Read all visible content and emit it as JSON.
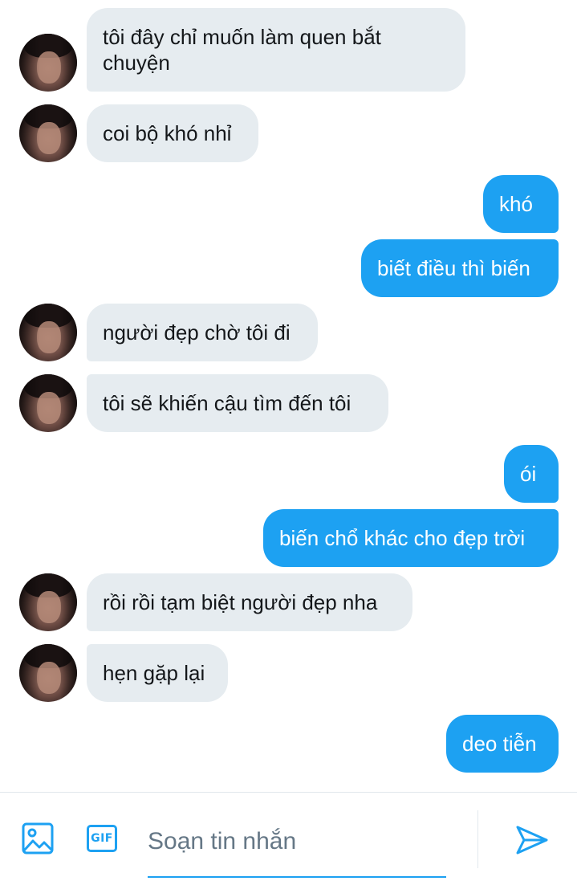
{
  "messages": [
    {
      "side": "in",
      "text": "tôi đây chỉ muốn làm quen bắt\nchuyện"
    },
    {
      "side": "in",
      "text": "coi bộ khó nhỉ"
    },
    {
      "side": "out",
      "text": "khó"
    },
    {
      "side": "out",
      "text": "biết điều thì biến"
    },
    {
      "side": "in",
      "text": "người đẹp chờ tôi đi"
    },
    {
      "side": "in",
      "text": "tôi sẽ khiến cậu tìm đến tôi"
    },
    {
      "side": "out",
      "text": "ói"
    },
    {
      "side": "out",
      "text": "biến chổ khác cho đẹp trời"
    },
    {
      "side": "in",
      "text": "rồi rồi tạm biệt người đẹp nha"
    },
    {
      "side": "in",
      "text": "hẹn gặp lại"
    },
    {
      "side": "out",
      "text": "deo tiễn"
    }
  ],
  "composer": {
    "placeholder": "Soạn tin nhắn",
    "gif_label": "GIF",
    "image_icon": "image-icon",
    "gif_icon": "gif-icon",
    "send_icon": "send-icon"
  },
  "colors": {
    "accent": "#1da1f2",
    "incoming_bubble": "#e6ecf0",
    "text": "#14171a",
    "placeholder": "#657786"
  }
}
